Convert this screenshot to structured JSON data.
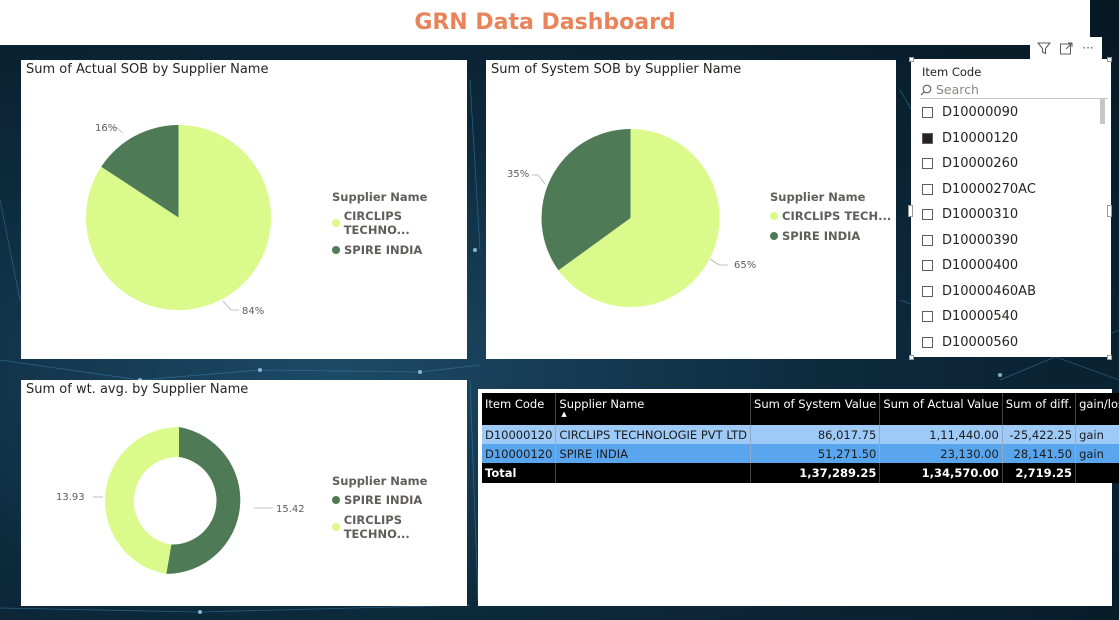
{
  "header": {
    "title": "GRN Data Dashboard"
  },
  "colors": {
    "light_green": "#dbfa8c",
    "dark_green": "#4e7a56",
    "title_orange": "#e8835a"
  },
  "toolbar": {
    "icons": [
      "filter-icon",
      "focus-mode-icon",
      "more-options-icon"
    ],
    "more_label": "···"
  },
  "actual_sob": {
    "title": "Sum of Actual SOB by Supplier Name",
    "legend_title": "Supplier Name",
    "legend": [
      "CIRCLIPS TECHNO...",
      "SPIRE INDIA"
    ],
    "labels": {
      "circlips": "84%",
      "spire": "16%"
    }
  },
  "system_sob": {
    "title": "Sum of System SOB by Supplier Name",
    "legend_title": "Supplier Name",
    "legend": [
      "CIRCLIPS TECH...",
      "SPIRE INDIA"
    ],
    "labels": {
      "circlips": "65%",
      "spire": "35%"
    }
  },
  "wt_avg": {
    "title": "Sum of wt. avg. by Supplier Name",
    "legend_title": "Supplier Name",
    "legend": [
      "SPIRE INDIA",
      "CIRCLIPS TECHNO..."
    ],
    "labels": {
      "spire": "15.42",
      "circlips": "13.93"
    }
  },
  "slicer": {
    "title": "Item Code",
    "search_placeholder": "Search",
    "items": [
      {
        "label": "D10000090",
        "checked": false
      },
      {
        "label": "D10000120",
        "checked": true
      },
      {
        "label": "D10000260",
        "checked": false
      },
      {
        "label": "D10000270AC",
        "checked": false
      },
      {
        "label": "D10000310",
        "checked": false
      },
      {
        "label": "D10000390",
        "checked": false
      },
      {
        "label": "D10000400",
        "checked": false
      },
      {
        "label": "D10000460AB",
        "checked": false
      },
      {
        "label": "D10000540",
        "checked": false
      },
      {
        "label": "D10000560",
        "checked": false
      }
    ]
  },
  "table": {
    "headers": [
      "Item Code",
      "Supplier Name",
      "Sum of System Value",
      "Sum of Actual Value",
      "Sum of diff.",
      "gain/loss"
    ],
    "rows": [
      [
        "D10000120",
        "CIRCLIPS TECHNOLOGIE  PVT  LTD",
        "86,017.75",
        "1,11,440.00",
        "-25,422.25",
        "gain"
      ],
      [
        "D10000120",
        "SPIRE INDIA",
        "51,271.50",
        "23,130.00",
        "28,141.50",
        "gain"
      ]
    ],
    "total": [
      "Total",
      "",
      "1,37,289.25",
      "1,34,570.00",
      "2,719.25",
      ""
    ]
  },
  "chart_data": [
    {
      "type": "pie",
      "title": "Sum of Actual SOB by Supplier Name",
      "legend_title": "Supplier Name",
      "categories": [
        "CIRCLIPS TECHNO...",
        "SPIRE INDIA"
      ],
      "values": [
        84,
        16
      ],
      "unit": "%"
    },
    {
      "type": "pie",
      "title": "Sum of System SOB by Supplier Name",
      "legend_title": "Supplier Name",
      "categories": [
        "CIRCLIPS TECH...",
        "SPIRE INDIA"
      ],
      "values": [
        65,
        35
      ],
      "unit": "%"
    },
    {
      "type": "pie",
      "variant": "donut",
      "title": "Sum of wt. avg. by Supplier Name",
      "legend_title": "Supplier Name",
      "categories": [
        "SPIRE INDIA",
        "CIRCLIPS TECHNO..."
      ],
      "values": [
        15.42,
        13.93
      ]
    }
  ]
}
